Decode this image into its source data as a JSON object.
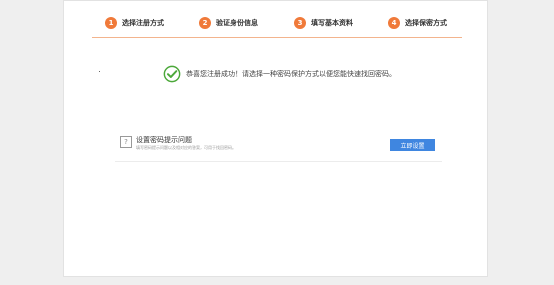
{
  "steps": [
    {
      "num": "1",
      "label": "选择注册方式"
    },
    {
      "num": "2",
      "label": "验证身份信息"
    },
    {
      "num": "3",
      "label": "填写基本资料"
    },
    {
      "num": "4",
      "label": "选择保密方式"
    }
  ],
  "success": {
    "icon": "check-circle-icon",
    "message": "恭喜您注册成功！请选择一种密码保护方式以便您能快速找回密码。"
  },
  "question": {
    "icon": "question-icon",
    "icon_glyph": "?",
    "title": "设置密码提示问题",
    "description": "填写密码提示问题以及相对应的答案，可用于找回密码。",
    "button_label": "立即设置"
  },
  "colors": {
    "accent": "#f07a3a",
    "button": "#3f86e0",
    "success": "#4ca83a"
  }
}
